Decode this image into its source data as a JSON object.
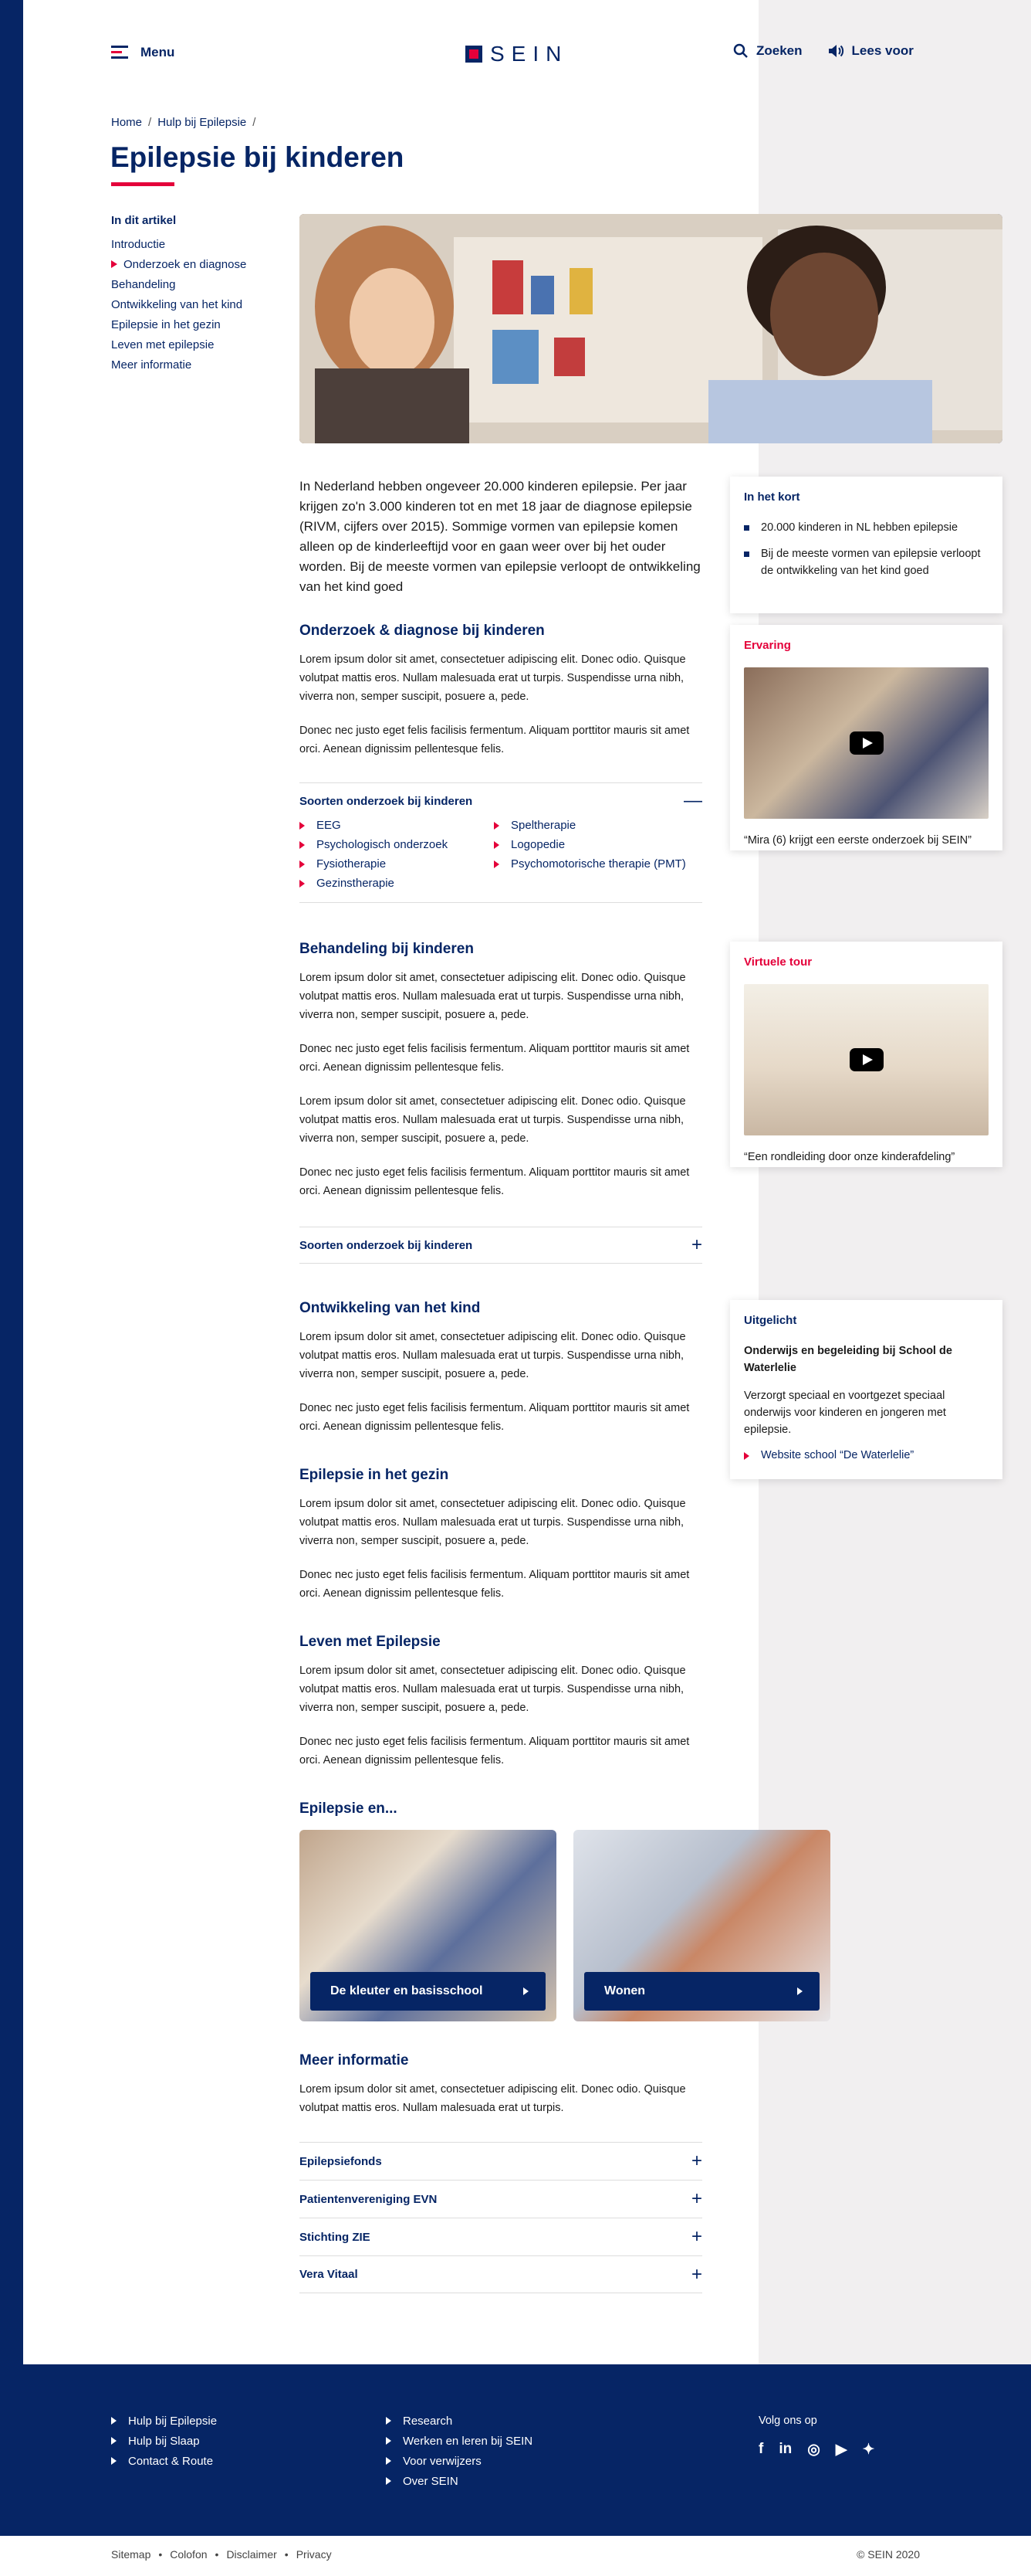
{
  "header": {
    "menu_label": "Menu",
    "logo_text": "SEIN",
    "search_label": "Zoeken",
    "readaloud_label": "Lees voor"
  },
  "breadcrumb": [
    "Home",
    "Hulp bij Epilepsie"
  ],
  "title": "Epilepsie bij kinderen",
  "toc": {
    "title": "In dit artikel",
    "items": [
      "Introductie",
      "Onderzoek en diagnose",
      "Behandeling",
      "Ontwikkeling van het kind",
      "Epilepsie in het gezin",
      "Leven met epilepsie",
      "Meer informatie"
    ]
  },
  "intro": "In Nederland hebben ongeveer 20.000 kinderen epilepsie. Per jaar krijgen zo'n 3.000 kinderen tot en met 18 jaar de diagnose epilepsie (RIVM, cijfers over 2015). Sommige vormen van epilepsie komen alleen op de kinderleeftijd voor en gaan weer over bij het ouder worden. Bij de meeste vormen van epilepsie verloopt de ontwikkeling van het kind goed",
  "lorem1": "Lorem ipsum dolor sit amet, consectetuer adipiscing elit. Donec odio. Quisque volutpat mattis eros. Nullam malesuada erat ut turpis. Suspendisse urna nibh, viverra non, semper suscipit, posuere a, pede.",
  "lorem2": "Donec nec justo eget felis facilisis fermentum. Aliquam porttitor mauris sit amet orci. Aenean dignissim pellentesque felis.",
  "sections": {
    "onderzoek": "Onderzoek & diagnose bij kinderen",
    "behandeling": "Behandeling bij kinderen",
    "ontwikkeling": "Ontwikkeling van het kind",
    "gezin": "Epilepsie in het gezin",
    "leven": "Leven met Epilepsie",
    "en": "Epilepsie en...",
    "meer": "Meer informatie"
  },
  "accordion1": {
    "title": "Soorten onderzoek bij kinderen",
    "items": [
      "EEG",
      "Speltherapie",
      "Psychologisch onderzoek",
      "Logopedie",
      "Fysiotherapie",
      "Psychomotorische therapie (PMT)",
      "Gezinstherapie"
    ]
  },
  "accordion2": {
    "title": "Soorten onderzoek bij kinderen"
  },
  "cards": {
    "kort": {
      "title": "In het kort",
      "items": [
        "20.000 kinderen in NL hebben epilepsie",
        "Bij de meeste vormen van epilepsie verloopt de ontwikkeling van het kind goed"
      ]
    },
    "ervaring": {
      "title": "Ervaring",
      "caption": "“Mira (6) krijgt een eerste onderzoek bij SEIN”"
    },
    "tour": {
      "title": "Virtuele tour",
      "caption": "“Een rondleiding door onze kinderafdeling”"
    },
    "uitgelicht": {
      "title": "Uitgelicht",
      "heading": "Onderwijs en begeleiding bij School de Waterlelie",
      "text": "Verzorgt speciaal en voortgezet speciaal onderwijs voor kinderen en jongeren met epilepsie.",
      "link": "Website school “De Waterlelie”"
    }
  },
  "tiles": [
    "De kleuter en basisschool",
    "Wonen"
  ],
  "meer_text": "Lorem ipsum dolor sit amet, consectetuer adipiscing elit. Donec odio. Quisque volutpat mattis eros. Nullam malesuada erat ut turpis.",
  "faq": [
    "Epilepsiefonds",
    "Patientenvereniging EVN",
    "Stichting ZIE",
    "Vera Vitaal"
  ],
  "footer": {
    "col1": [
      "Hulp bij Epilepsie",
      "Hulp bij Slaap",
      "Contact & Route"
    ],
    "col2": [
      "Research",
      "Werken en leren bij SEIN",
      "Voor verwijzers",
      "Over SEIN"
    ],
    "social_title": "Volg ons op",
    "bottom": [
      "Sitemap",
      "Colofon",
      "Disclaimer",
      "Privacy"
    ],
    "copyright": "© SEIN 2020"
  },
  "colors": {
    "navy": "#062565",
    "red": "#e4003a"
  }
}
